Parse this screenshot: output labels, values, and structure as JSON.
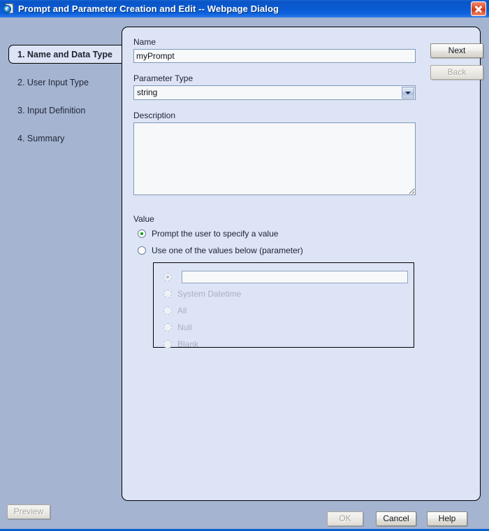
{
  "window": {
    "title": "Prompt and Parameter Creation and Edit -- Webpage Dialog",
    "icon": "ie-page-icon",
    "close_label": "close-icon"
  },
  "nav": {
    "items": [
      {
        "label": "1. Name and Data Type",
        "active": true
      },
      {
        "label": "2. User Input Type",
        "active": false
      },
      {
        "label": "3. Input Definition",
        "active": false
      },
      {
        "label": "4. Summary",
        "active": false
      }
    ]
  },
  "form": {
    "name_label": "Name",
    "name_value": "myPrompt",
    "name_placeholder": "",
    "parameter_type_label": "Parameter Type",
    "parameter_type_value": "string",
    "description_label": "Description",
    "description_value": "",
    "description_placeholder": ""
  },
  "value_section": {
    "label": "Value",
    "options": [
      {
        "label": "Prompt the user to specify a value",
        "checked": true,
        "disabled": false
      },
      {
        "label": "Use one of the values below (parameter)",
        "checked": false,
        "disabled": false
      }
    ],
    "group": {
      "input_value": "",
      "input_placeholder": "",
      "input_radio_checked": true,
      "items": [
        {
          "label": "System Datetime",
          "checked": false,
          "disabled": true
        },
        {
          "label": "All",
          "checked": false,
          "disabled": true
        },
        {
          "label": "Null",
          "checked": false,
          "disabled": true
        },
        {
          "label": "Blank",
          "checked": false,
          "disabled": true
        }
      ]
    }
  },
  "side_buttons": {
    "next": "Next",
    "back": "Back"
  },
  "bottom_buttons": {
    "preview": "Preview",
    "ok": "OK",
    "cancel": "Cancel",
    "help": "Help"
  },
  "colors": {
    "titlebar_blue": "#0a5ad2",
    "dialog_bg": "#a5b4d0",
    "panel_bg": "#dde4f5",
    "input_bg": "#f7f8fa",
    "radio_checked_green": "#00a000",
    "close_red": "#cf3a1c"
  }
}
